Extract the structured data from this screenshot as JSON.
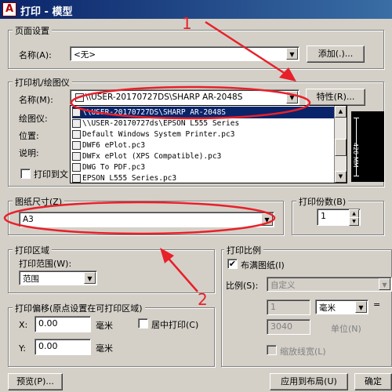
{
  "titlebar": {
    "app_icon": "A",
    "title": "打印 - 模型"
  },
  "page_setup": {
    "group_label": "页面设置",
    "name_label": "名称(A):",
    "name_value": "<无>",
    "add_button": "添加(.)..."
  },
  "printer": {
    "group_label": "打印机/绘图仪",
    "name_label": "名称(M):",
    "name_value": "\\\\USER-20170727DS\\SHARP AR-2048S",
    "properties_button": "特性(R)...",
    "plotter_label": "绘图仪:",
    "location_label": "位置:",
    "description_label": "说明:",
    "print_to_file_label": "打印到文",
    "dropdown_items": [
      "\\\\USER-20170727DS\\SHARP AR-2048S",
      "\\\\USER-20170727ds\\EPSON L555 Series",
      "Default Windows System Printer.pc3",
      "DWF6 ePlot.pc3",
      "DWFx ePlot (XPS Compatible).pc3",
      "DWG To PDF.pc3",
      "EPSON L555 Series.pc3"
    ],
    "preview_dimension": "420 MM"
  },
  "paper_size": {
    "group_label": "图纸尺寸(Z)",
    "value": "A3"
  },
  "copies": {
    "group_label": "打印份数(B)",
    "value": "1"
  },
  "plot_area": {
    "group_label": "打印区域",
    "range_label": "打印范围(W):",
    "range_value": "范围"
  },
  "plot_offset": {
    "group_label": "打印偏移(原点设置在可打印区域)",
    "x_label": "X:",
    "x_value": "0.00",
    "y_label": "Y:",
    "y_value": "0.00",
    "unit": "毫米",
    "center_label": "居中打印(C)"
  },
  "plot_scale": {
    "group_label": "打印比例",
    "fit_label": "布满图纸(I)",
    "fit_checked": "✔",
    "scale_label": "比例(S):",
    "scale_value": "自定义",
    "value1": "1",
    "unit_value": "毫米",
    "equals": "=",
    "value2": "3040",
    "unit_label": "单位(N)",
    "lineweights_label": "缩放线宽(L)"
  },
  "footer": {
    "preview_button": "预览(P)...",
    "apply_button": "应用到布局(U)",
    "ok_button": "确定"
  },
  "annotations": {
    "number1": "1",
    "number2": "2",
    "arrow_color": "#e8202a"
  }
}
